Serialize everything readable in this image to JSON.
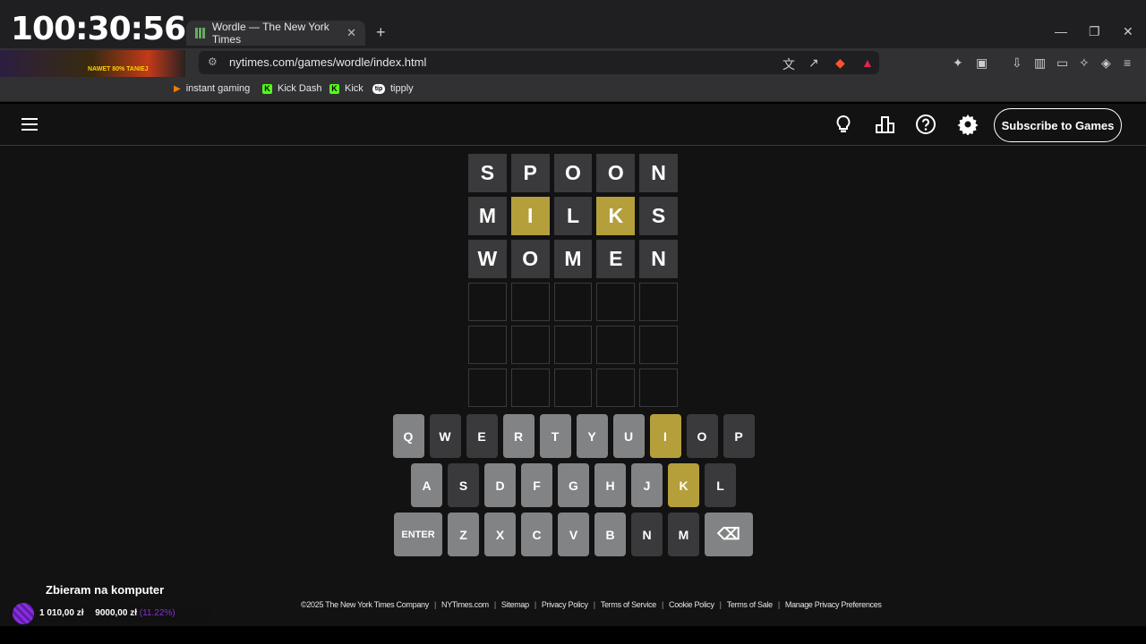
{
  "overlay": {
    "timer": "100:30:56"
  },
  "browser": {
    "tab_title": "Wordle — The New York Times",
    "tab_close": "✕",
    "new_tab": "+",
    "url": "nytimes.com/games/wordle/index.html",
    "window_controls": [
      "—",
      "❐",
      "✕"
    ],
    "bookmarks": [
      "instant gaming",
      "Kick Dash",
      "Kick",
      "tipply"
    ],
    "ad_text": "NAWET 80% TANIEJ"
  },
  "header": {
    "subscribe_label": "Subscribe to Games",
    "icons": [
      "menu-icon",
      "lightbulb-icon",
      "stats-icon",
      "help-icon",
      "settings-icon"
    ]
  },
  "board": {
    "rows": [
      {
        "letters": [
          "S",
          "P",
          "O",
          "O",
          "N"
        ],
        "states": [
          "absent",
          "absent",
          "absent",
          "absent",
          "absent"
        ]
      },
      {
        "letters": [
          "M",
          "I",
          "L",
          "K",
          "S"
        ],
        "states": [
          "absent",
          "present",
          "absent",
          "present",
          "absent"
        ]
      },
      {
        "letters": [
          "W",
          "O",
          "M",
          "E",
          "N"
        ],
        "states": [
          "absent",
          "absent",
          "absent",
          "absent",
          "absent"
        ]
      },
      {
        "letters": [
          "",
          "",
          "",
          "",
          ""
        ],
        "states": [
          "empty",
          "empty",
          "empty",
          "empty",
          "empty"
        ]
      },
      {
        "letters": [
          "",
          "",
          "",
          "",
          ""
        ],
        "states": [
          "empty",
          "empty",
          "empty",
          "empty",
          "empty"
        ]
      },
      {
        "letters": [
          "",
          "",
          "",
          "",
          ""
        ],
        "states": [
          "empty",
          "empty",
          "empty",
          "empty",
          "empty"
        ]
      }
    ]
  },
  "keyboard": {
    "rows": [
      [
        {
          "k": "Q",
          "s": "unused"
        },
        {
          "k": "W",
          "s": "absent"
        },
        {
          "k": "E",
          "s": "absent"
        },
        {
          "k": "R",
          "s": "unused"
        },
        {
          "k": "T",
          "s": "unused"
        },
        {
          "k": "Y",
          "s": "unused"
        },
        {
          "k": "U",
          "s": "unused"
        },
        {
          "k": "I",
          "s": "present"
        },
        {
          "k": "O",
          "s": "absent"
        },
        {
          "k": "P",
          "s": "absent"
        }
      ],
      [
        {
          "k": "A",
          "s": "unused"
        },
        {
          "k": "S",
          "s": "absent"
        },
        {
          "k": "D",
          "s": "unused"
        },
        {
          "k": "F",
          "s": "unused"
        },
        {
          "k": "G",
          "s": "unused"
        },
        {
          "k": "H",
          "s": "unused"
        },
        {
          "k": "J",
          "s": "unused"
        },
        {
          "k": "K",
          "s": "present"
        },
        {
          "k": "L",
          "s": "absent"
        }
      ],
      [
        {
          "k": "ENTER",
          "s": "unused"
        },
        {
          "k": "Z",
          "s": "unused"
        },
        {
          "k": "X",
          "s": "unused"
        },
        {
          "k": "C",
          "s": "unused"
        },
        {
          "k": "V",
          "s": "unused"
        },
        {
          "k": "B",
          "s": "unused"
        },
        {
          "k": "N",
          "s": "absent"
        },
        {
          "k": "M",
          "s": "absent"
        },
        {
          "k": "⌫",
          "s": "unused"
        }
      ]
    ]
  },
  "footer": [
    "©2025 The New York Times Company",
    "NYTimes.com",
    "Sitemap",
    "Privacy Policy",
    "Terms of Service",
    "Cookie Policy",
    "Terms of Sale",
    "Manage Privacy Preferences"
  ],
  "donation": {
    "title": "Zbieram na komputer",
    "current": "1 010,00 zł",
    "goal": "9000,00 zł",
    "percent": "(11.22%)"
  },
  "colors": {
    "absent": "#3a3a3c",
    "present": "#b59f3b",
    "correct": "#538d4e",
    "unused": "#818384"
  }
}
